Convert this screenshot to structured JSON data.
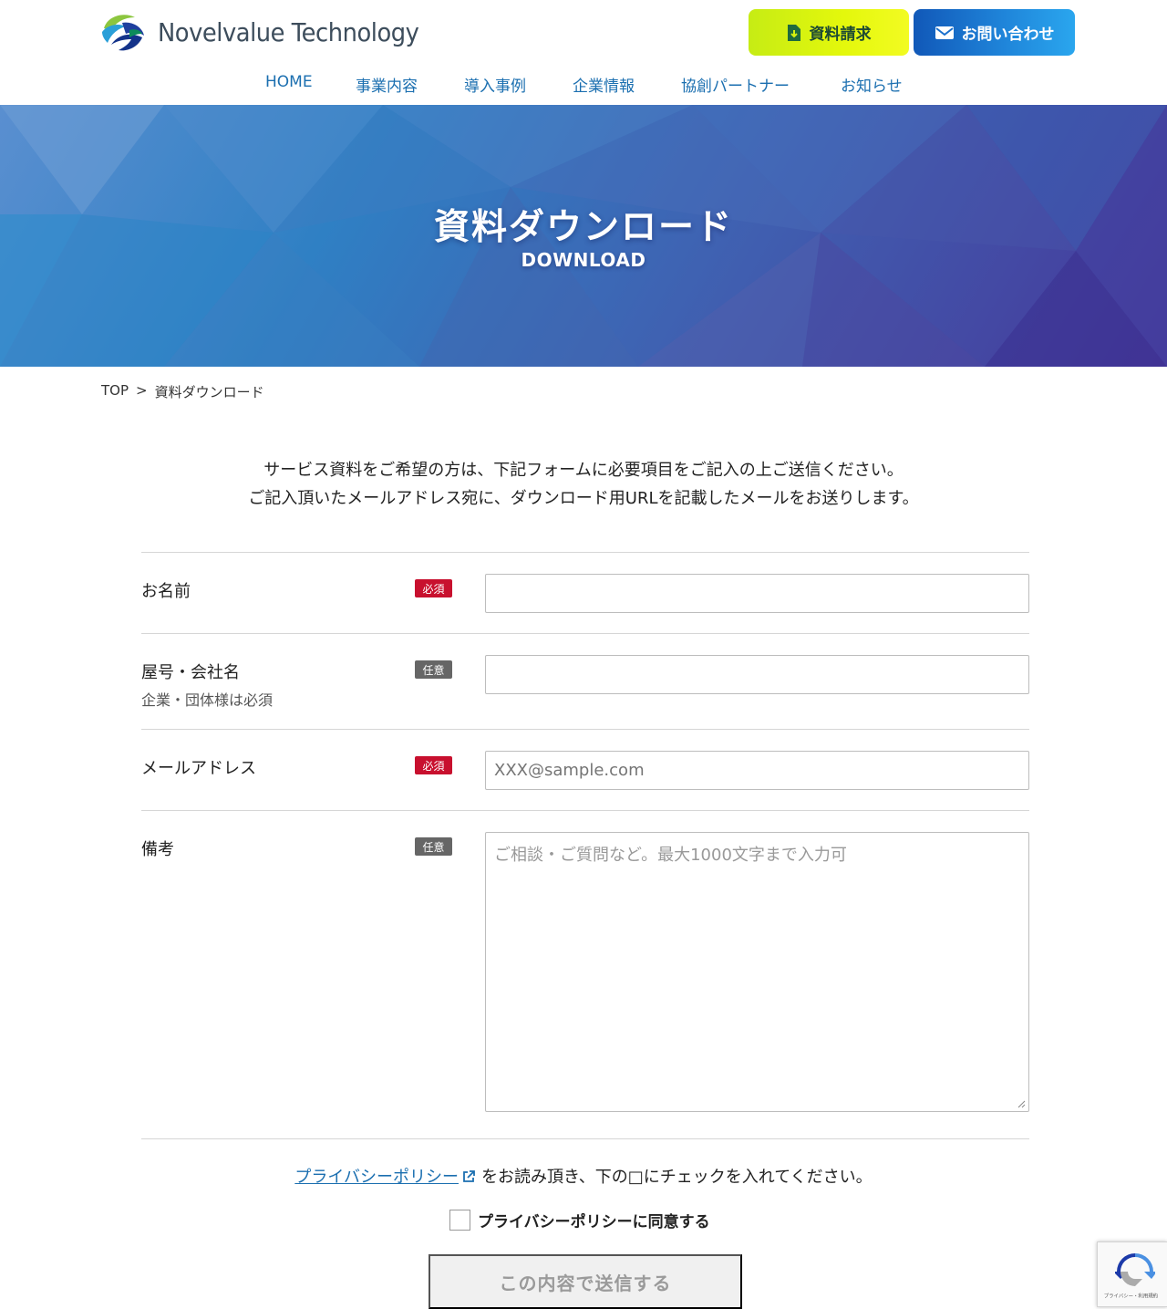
{
  "header": {
    "logo_text": "Novelvalue Technology",
    "request_button": "資料請求",
    "contact_button": "お問い合わせ"
  },
  "nav": {
    "items": [
      "HOME",
      "事業内容",
      "導入事例",
      "企業情報",
      "協創パートナー",
      "お知らせ"
    ]
  },
  "hero": {
    "title": "資料ダウンロード",
    "subtitle": "DOWNLOAD"
  },
  "breadcrumb": {
    "top": "TOP",
    "separator": ">",
    "current": "資料ダウンロード"
  },
  "intro": {
    "line1": "サービス資料をご希望の方は、下記フォームに必要項目をご記入の上ご送信ください。",
    "line2": "ご記入頂いたメールアドレス宛に、ダウンロード用URLを記載したメールをお送りします。"
  },
  "form": {
    "name": {
      "label": "お名前",
      "badge": "必須",
      "value": "",
      "placeholder": ""
    },
    "company": {
      "label": "屋号・会社名",
      "sublabel": "企業・団体様は必須",
      "badge": "任意",
      "value": "",
      "placeholder": ""
    },
    "email": {
      "label": "メールアドレス",
      "badge": "必須",
      "value": "",
      "placeholder": "XXX@sample.com"
    },
    "notes": {
      "label": "備考",
      "badge": "任意",
      "value": "",
      "placeholder": "ご相談・ご質問など。最大1000文字まで入力可"
    }
  },
  "privacy": {
    "link_text": "プライバシーポリシー",
    "instruction": "をお読み頂き、下の□にチェックを入れてください。",
    "agree_label": "プライバシーポリシーに同意する",
    "agreed": false
  },
  "submit": {
    "label": "この内容で送信する"
  },
  "recaptcha": {
    "footer_text": "プライバシー・利用規約"
  },
  "colors": {
    "nav_link": "#1b6fb0",
    "required_badge": "#c8102e",
    "optional_badge": "#666666",
    "request_button": "#d4f20e",
    "contact_button": "#1a6fcc"
  }
}
